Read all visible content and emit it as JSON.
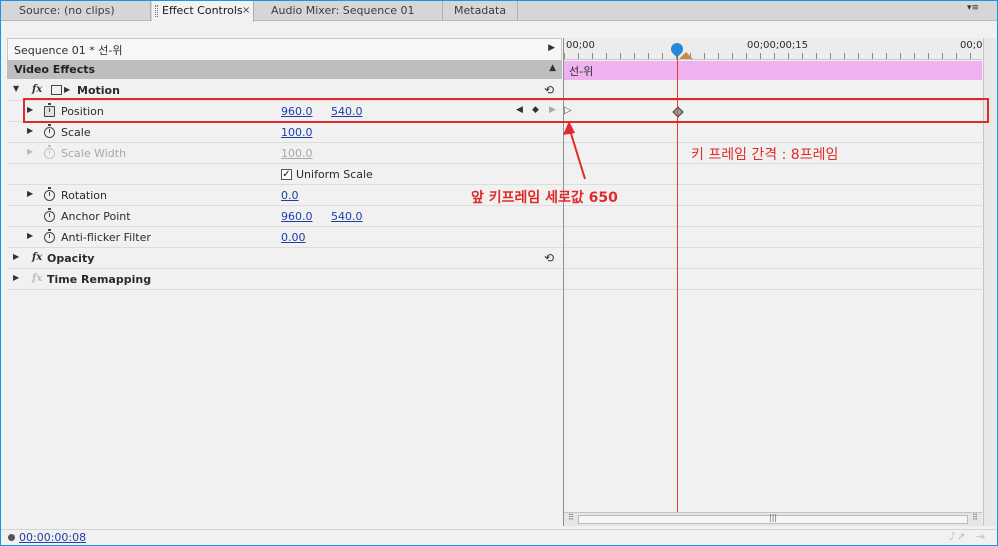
{
  "tabs": [
    {
      "label": "Source: (no clips)",
      "active": false
    },
    {
      "label": "Effect Controls",
      "active": true,
      "close": "×"
    },
    {
      "label": "Audio Mixer: Sequence 01",
      "active": false
    },
    {
      "label": "Metadata",
      "active": false
    }
  ],
  "panel_menu_icon": "▾≡",
  "sequence": {
    "label": "Sequence 01 * 선-위"
  },
  "section_header": "Video Effects",
  "effects": {
    "motion": {
      "label": "Motion"
    },
    "position": {
      "label": "Position",
      "x": "960.0",
      "y": "540.0"
    },
    "scale": {
      "label": "Scale",
      "value": "100.0"
    },
    "scale_width": {
      "label": "Scale Width",
      "value": "100.0"
    },
    "uniform_scale": {
      "label": "Uniform Scale",
      "checked": "✓"
    },
    "rotation": {
      "label": "Rotation",
      "value": "0.0"
    },
    "anchor_point": {
      "label": "Anchor Point",
      "x": "960.0",
      "y": "540.0"
    },
    "anti_flicker": {
      "label": "Anti-flicker Filter",
      "value": "0.00"
    },
    "opacity": {
      "label": "Opacity"
    },
    "time_remapping": {
      "label": "Time Remapping"
    }
  },
  "timeline": {
    "time_start": "00;00",
    "time_mid": "00;00;00;15",
    "time_end": "00;0",
    "clip_label": "선-위"
  },
  "bottom": {
    "timecode": "00:00:00:08"
  },
  "annotations": {
    "keyframe_interval": "키 프레임 간격 : 8프레임",
    "prev_keyframe_value": "앞 키프레임 세로값 650"
  },
  "colors": {
    "accent": "#1f93e8",
    "annotation": "#e02b2b",
    "clip": "#efb1f0",
    "playhead": "#e53a3a"
  }
}
